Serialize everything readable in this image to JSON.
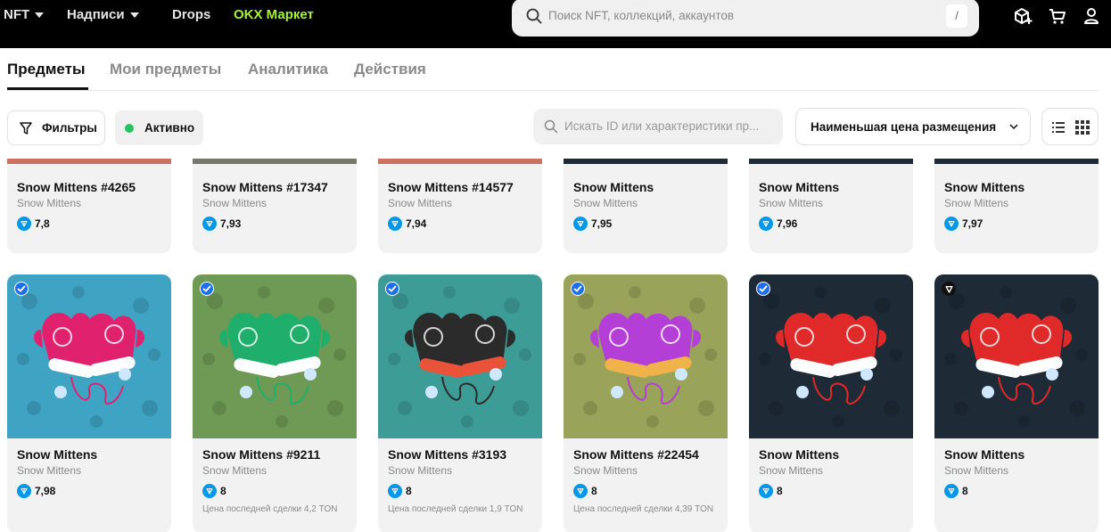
{
  "header": {
    "nav": [
      {
        "label": "NFT",
        "dropdown": true
      },
      {
        "label": "Надписи",
        "dropdown": true
      },
      {
        "label": "Drops",
        "dropdown": false
      },
      {
        "label": "OKX Маркет",
        "dropdown": false
      }
    ],
    "search_placeholder": "Поиск NFT, коллекций, аккаунтов",
    "search_shortcut": "/",
    "icons": [
      "cube-plus-icon",
      "cart-icon",
      "user-icon"
    ]
  },
  "tabs": [
    {
      "label": "Предметы",
      "active": true
    },
    {
      "label": "Мои предметы",
      "active": false
    },
    {
      "label": "Аналитика",
      "active": false
    },
    {
      "label": "Действия",
      "active": false
    }
  ],
  "toolbar": {
    "filter_label": "Фильтры",
    "status_label": "Активно",
    "search_placeholder": "Искать ID или характеристики пр...",
    "sort_label": "Наименьшая цена размещения",
    "view_modes": [
      "list",
      "grid"
    ],
    "active_view": "grid"
  },
  "colors": {
    "accent_green": "#a6f23b",
    "status_green": "#22c55e",
    "ton_blue": "#0098ea"
  },
  "cards_row1": [
    {
      "title": "Snow Mittens #4265",
      "collection": "Snow Mittens",
      "price": "7,8",
      "strip": "#c8745a"
    },
    {
      "title": "Snow Mittens #17347",
      "collection": "Snow Mittens",
      "price": "7,93",
      "strip": "#75786a"
    },
    {
      "title": "Snow Mittens #14577",
      "collection": "Snow Mittens",
      "price": "7,94",
      "strip": "#c8745a"
    },
    {
      "title": "Snow Mittens",
      "collection": "Snow Mittens",
      "price": "7,95",
      "strip": "#1e2a35"
    },
    {
      "title": "Snow Mittens",
      "collection": "Snow Mittens",
      "price": "7,96",
      "strip": "#1e2a35"
    },
    {
      "title": "Snow Mittens",
      "collection": "Snow Mittens",
      "price": "7,97",
      "strip": "#1e2a35"
    }
  ],
  "cards_row2": [
    {
      "title": "Snow Mittens",
      "collection": "Snow Mittens",
      "price": "7,98",
      "last_sale": "",
      "bg": "#3fa3c4",
      "mitten": "#e0226e",
      "cuff": "#ffffff",
      "badge": "check"
    },
    {
      "title": "Snow Mittens #9211",
      "collection": "Snow Mittens",
      "price": "8",
      "last_sale": "Цена последней сделки 4,2 TON",
      "bg": "#6f9a55",
      "mitten": "#1fae6c",
      "cuff": "#ffffff",
      "badge": "check"
    },
    {
      "title": "Snow Mittens #3193",
      "collection": "Snow Mittens",
      "price": "8",
      "last_sale": "Цена последней сделки 1,9 TON",
      "bg": "#3e9c97",
      "mitten": "#2b2b2b",
      "cuff": "#e8533a",
      "badge": "check"
    },
    {
      "title": "Snow Mittens #22454",
      "collection": "Snow Mittens",
      "price": "8",
      "last_sale": "Цена последней сделки 4,39 TON",
      "bg": "#9aa35a",
      "mitten": "#b33fd6",
      "cuff": "#f0b24a",
      "badge": "check"
    },
    {
      "title": "Snow Mittens",
      "collection": "Snow Mittens",
      "price": "8",
      "last_sale": "",
      "bg": "#1e2a35",
      "mitten": "#e02a2a",
      "cuff": "#ffffff",
      "badge": "check"
    },
    {
      "title": "Snow Mittens",
      "collection": "Snow Mittens",
      "price": "8",
      "last_sale": "",
      "bg": "#1e2a35",
      "mitten": "#e02a2a",
      "cuff": "#ffffff",
      "badge": "ton"
    }
  ]
}
